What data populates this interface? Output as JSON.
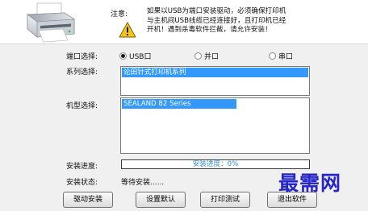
{
  "notice": {
    "label": "注意:",
    "text": "如果以USB为端口安装驱动，必须确保打印机\n与主机间USB线缆已经连接好，且打印机已经\n开机！遇到杀毒软件拦截，请允许安装！"
  },
  "port": {
    "label": "端口选择:",
    "options": [
      "USB口",
      "并口",
      "串口"
    ],
    "selected": "USB口"
  },
  "series": {
    "label": "系列选择:",
    "selected": "论田针式打印机系列"
  },
  "model": {
    "label": "机型选择:",
    "selected": "SEALAND 82 Series"
  },
  "progress": {
    "label": "安装进度:",
    "text": "安装进度：0%",
    "value": 0
  },
  "status": {
    "label": "安装状态:",
    "value": "等待安装......"
  },
  "buttons": {
    "install": "驱动安装",
    "set_default": "设置默认",
    "test_print": "打印测试",
    "exit": "退出软件"
  },
  "watermark": "最需网",
  "icons": [
    "printer-icon",
    "warning-icon"
  ],
  "colors": {
    "selection": "#3399ff",
    "progress_text": "#2f8fd0",
    "watermark": "#2626c8"
  }
}
